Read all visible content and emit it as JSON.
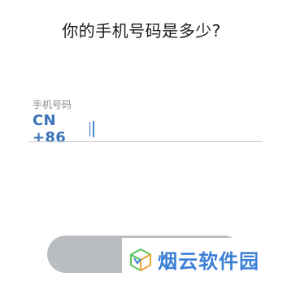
{
  "page": {
    "title": "你的手机号码是多少?"
  },
  "phone_field": {
    "label": "手机号码",
    "country_code": "CN +86",
    "value": "",
    "placeholder": ""
  },
  "next_button": {
    "label": ""
  },
  "watermark": {
    "text": "烟云软件园",
    "logo_icon": "cube-logo-icon"
  },
  "colors": {
    "accent": "#3a73b8",
    "caret": "#4a86d8",
    "button_disabled": "#b9bcc1",
    "watermark_blue": "#3b7fd6",
    "logo_green": "#5cc45a",
    "logo_orange": "#f2a33a"
  }
}
